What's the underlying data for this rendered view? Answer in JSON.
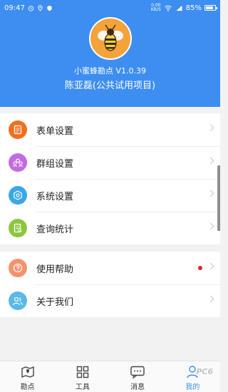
{
  "status_bar": {
    "time": "09:47",
    "net_speed_value": "0.00",
    "net_speed_unit": "KB/S",
    "battery": "85%",
    "battery_level": 0.85
  },
  "profile": {
    "app_version": "小蜜蜂勘点 V1.0.39",
    "user_name": "陈亚磊(公共试用项目)"
  },
  "menu_group_1": [
    {
      "label": "表单设置",
      "icon": "form-icon",
      "color": "#f0701e"
    },
    {
      "label": "群组设置",
      "icon": "group-icon",
      "color": "#c36be0"
    },
    {
      "label": "系统设置",
      "icon": "settings-icon",
      "color": "#3aa6e6"
    },
    {
      "label": "查询统计",
      "icon": "query-icon",
      "color": "#8cc63e"
    }
  ],
  "menu_group_2": [
    {
      "label": "使用帮助",
      "icon": "help-icon",
      "color": "#f5926e",
      "badge": true
    },
    {
      "label": "关于我们",
      "icon": "about-icon",
      "color": "#5ab8ea"
    }
  ],
  "tabbar": {
    "tabs": [
      {
        "label": "勘点",
        "icon": "map-icon"
      },
      {
        "label": "工具",
        "icon": "grid-icon"
      },
      {
        "label": "消息",
        "icon": "chat-icon"
      },
      {
        "label": "我的",
        "icon": "person-icon",
        "active": true
      }
    ],
    "watermark": "PC6"
  },
  "colors": {
    "accent": "#3d8ef0",
    "badge": "#e8231f"
  }
}
